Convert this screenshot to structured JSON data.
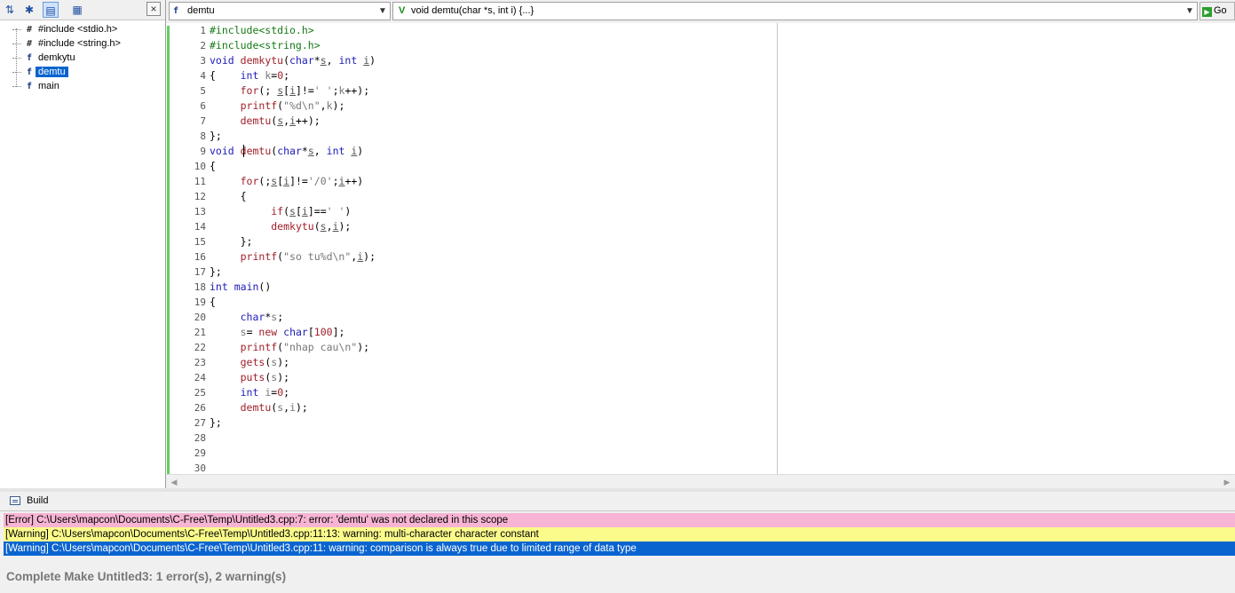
{
  "tree": {
    "items": [
      {
        "icon": "#",
        "label": "#include <stdio.h>",
        "selected": false
      },
      {
        "icon": "#",
        "label": "#include <string.h>",
        "selected": false
      },
      {
        "icon": "f",
        "label": "demkytu",
        "selected": false
      },
      {
        "icon": "f",
        "label": "demtu",
        "selected": true
      },
      {
        "icon": "f",
        "label": "main",
        "selected": false
      }
    ],
    "close_label": "×"
  },
  "toolbar": {
    "function_combo": "demtu",
    "signature_combo": "void demtu(char *s, int i) {...}",
    "go_label": "Go"
  },
  "editor": {
    "line_numbers": [
      "1",
      "2",
      "3",
      "4",
      "5",
      "6",
      "7",
      "8",
      "9",
      "10",
      "11",
      "12",
      "13",
      "14",
      "15",
      "16",
      "17",
      "18",
      "19",
      "20",
      "21",
      "22",
      "23",
      "24",
      "25",
      "26",
      "27",
      "28",
      "29",
      "30"
    ]
  },
  "build": {
    "title": "Build",
    "messages": [
      "[Error] C:\\Users\\mapcon\\Documents\\C-Free\\Temp\\Untitled3.cpp:7: error: 'demtu' was not declared in this scope",
      "[Warning] C:\\Users\\mapcon\\Documents\\C-Free\\Temp\\Untitled3.cpp:11:13: warning: multi-character character constant",
      "[Warning] C:\\Users\\mapcon\\Documents\\C-Free\\Temp\\Untitled3.cpp:11: warning: comparison is always true due to limited range of data type"
    ],
    "summary": "Complete Make Untitled3: 1 error(s), 2 warning(s)"
  },
  "colors": {
    "error_bg": "#f7b4d4",
    "warning_bg": "#fbfb8c",
    "selected_bg": "#0a64d0",
    "change_bar": "#5fd05f"
  }
}
